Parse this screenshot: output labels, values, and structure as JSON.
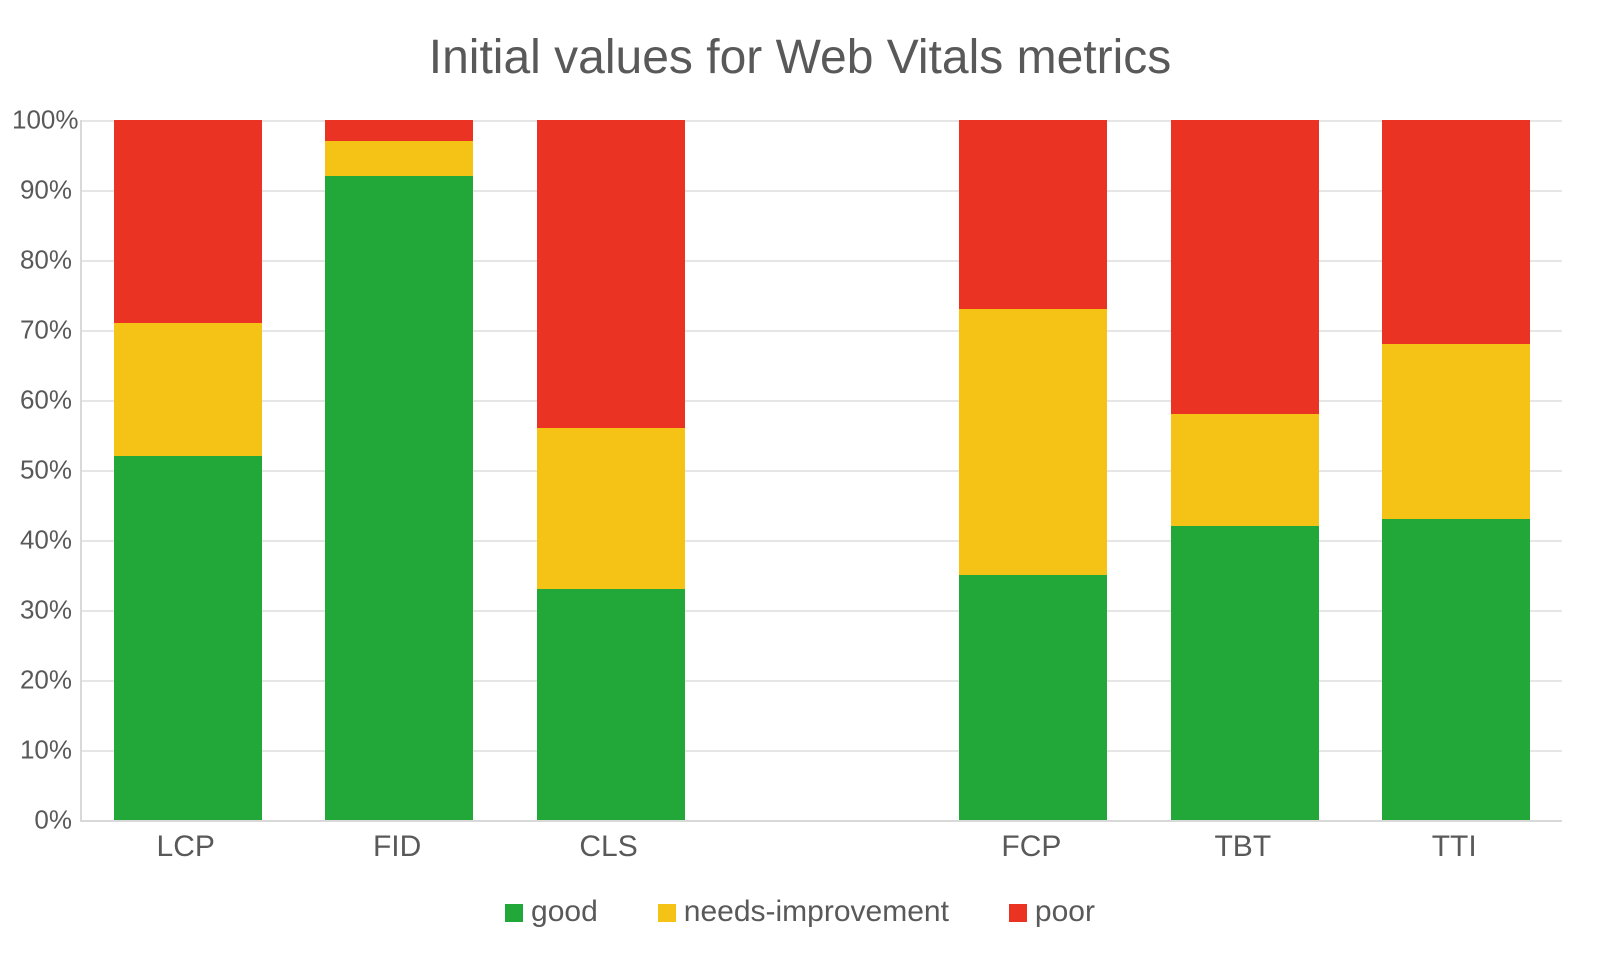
{
  "chart_data": {
    "type": "bar",
    "stacked": true,
    "title": "Initial values for Web Vitals metrics",
    "xlabel": "",
    "ylabel": "",
    "ylim": [
      0,
      100
    ],
    "yticks": [
      0,
      10,
      20,
      30,
      40,
      50,
      60,
      70,
      80,
      90,
      100
    ],
    "ytick_labels": [
      "0%",
      "10%",
      "20%",
      "30%",
      "40%",
      "50%",
      "60%",
      "70%",
      "80%",
      "90%",
      "100%"
    ],
    "categories": [
      "LCP",
      "FID",
      "CLS",
      "",
      "FCP",
      "TBT",
      "TTI"
    ],
    "gap_indices": [
      3
    ],
    "series": [
      {
        "name": "good",
        "values": [
          52,
          92,
          33,
          null,
          35,
          42,
          43
        ]
      },
      {
        "name": "needs-improvement",
        "values": [
          19,
          5,
          23,
          null,
          38,
          16,
          25
        ]
      },
      {
        "name": "poor",
        "values": [
          29,
          3,
          44,
          null,
          27,
          42,
          32
        ]
      }
    ],
    "colors": {
      "good": "#21a838",
      "needs-improvement": "#f4c316",
      "poor": "#eb3324"
    }
  },
  "legend": {
    "good_label": "good",
    "needs_label": "needs-improvement",
    "poor_label": "poor"
  }
}
